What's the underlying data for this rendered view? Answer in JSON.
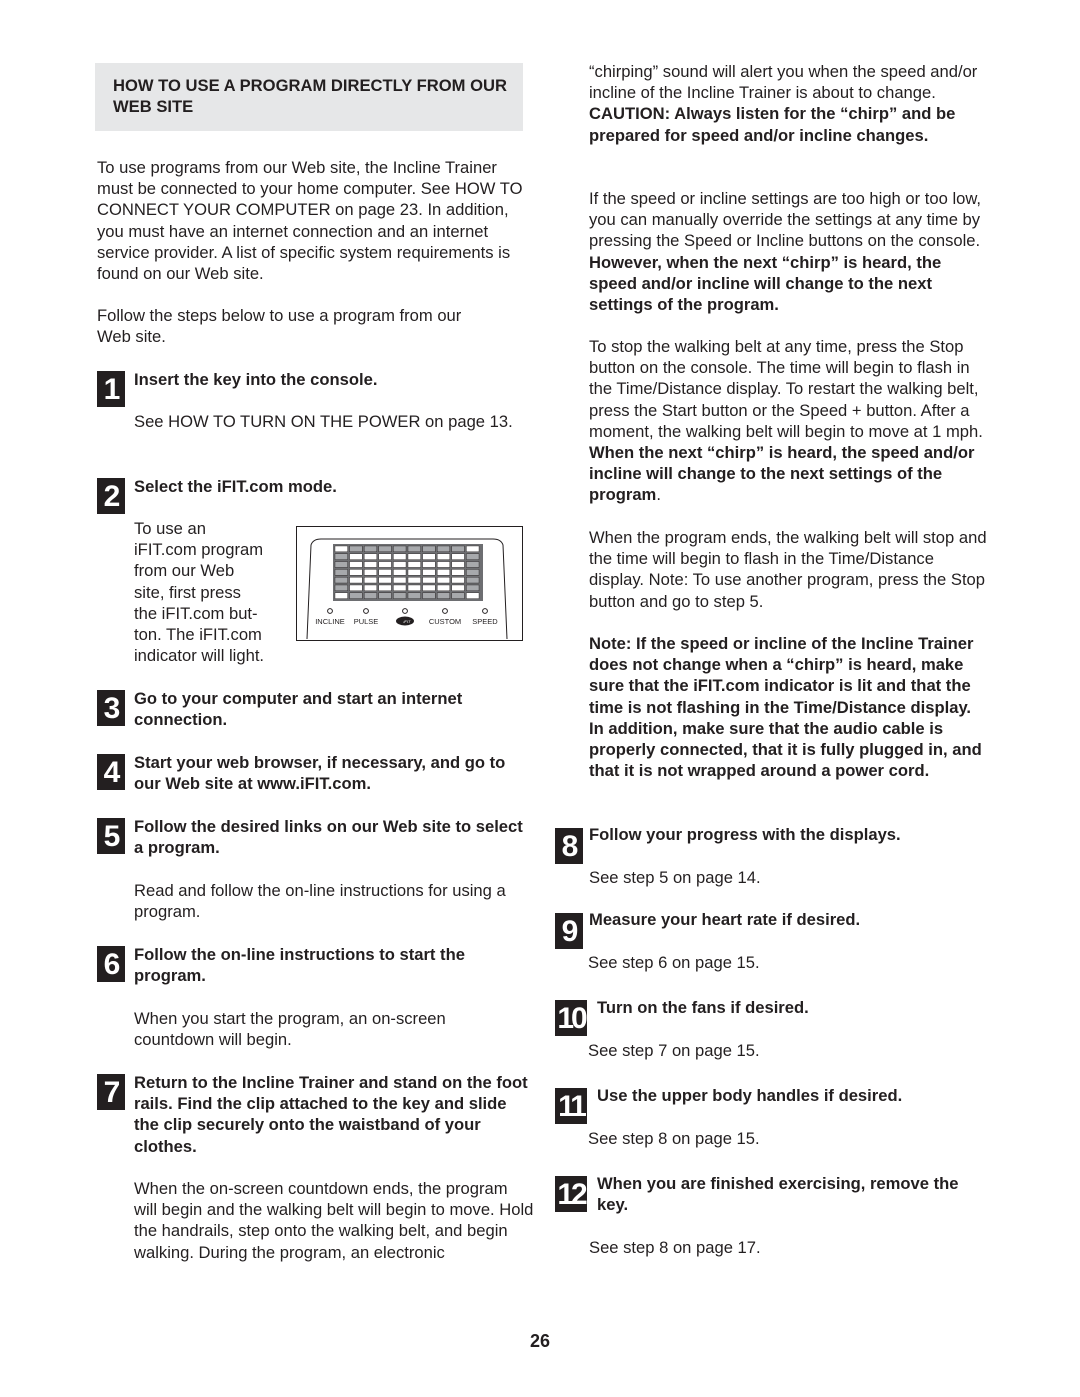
{
  "section_heading": "HOW TO USE A PROGRAM DIRECTLY FROM OUR WEB SITE",
  "intro": [
    "To use programs from our Web site, the Incline Trainer must be connected to your home computer. See HOW TO CONNECT YOUR COMPUTER on page 23. In addition, you must have an internet connection and an internet service provider. A list of specific system requirements is found on our Web site.",
    "Follow the steps below to use a program from our Web site."
  ],
  "steps": [
    {
      "number": "1",
      "title": "Insert the key into the console.",
      "body": "See HOW TO TURN ON THE POWER on page 13."
    },
    {
      "number": "2",
      "title": "Select the iFIT.com mode.",
      "body": "To use an iFIT.com program from our Web site, first press the iFIT.com button. The iFIT.com indicator will light."
    },
    {
      "number": "3",
      "title": "Go to your computer and start an internet connection."
    },
    {
      "number": "4",
      "title": "Start your web browser, if necessary, and go to our Web site at www.iFIT.com."
    },
    {
      "number": "5",
      "title": "Follow the desired links on our Web site to select a program.",
      "body": "Read and follow the on-line instructions for using a program."
    },
    {
      "number": "6",
      "title": "Follow the on-line instructions to start the program.",
      "body": "When you start the program, an on-screen countdown will begin."
    },
    {
      "number": "7",
      "title": "Return to the Incline Trainer and stand on the foot rails. Find the clip attached to the key and slide the clip securely onto the waistband of your clothes.",
      "body": "When the on-screen countdown ends, the program will begin and the walking belt will begin to move. Hold the handrails, step onto the walking belt, and begin walking. During the program, an electronic"
    },
    {
      "number": "8",
      "title": "Follow your progress with the displays.",
      "body": "See step 5 on page 14."
    },
    {
      "number": "9",
      "title": "Measure your heart rate if desired.",
      "body": "See step 6 on page 15."
    },
    {
      "number": "10",
      "title": "Turn on the fans if desired.",
      "body": "See step 7 on page 15."
    },
    {
      "number": "11",
      "title": "Use the upper body handles if desired.",
      "body": "See step 8 on page 15."
    },
    {
      "number": "12",
      "title": "When you are finished exercising, remove the key.",
      "body": "See step 8 on page 17."
    }
  ],
  "step2_lines": [
    "To use an",
    "iFIT.com program",
    "from our Web",
    "site, first press",
    "the iFIT.com but-",
    "ton. The iFIT.com",
    "indicator will light."
  ],
  "console_labels": [
    "INCLINE",
    "PULSE",
    "iFIT.com",
    "CUSTOM",
    "SPEED"
  ],
  "right_column": {
    "p1_plain": "“chirping” sound will alert you when the speed and/or incline of the Incline Trainer is about to change. ",
    "p1_bold": "CAUTION: Always listen for the “chirp” and be prepared for speed and/or incline changes.",
    "p2_plain": "If the speed or incline settings are too high or too low, you can manually override the settings at any time by pressing the Speed or Incline buttons on the console. ",
    "p2_bold": "However, when the next “chirp” is heard, the speed and/or incline will change to the next settings of the program.",
    "p3_plain": "To stop the walking belt at any time, press the Stop button on the console. The time will begin to flash in the Time/Distance display. To restart the walking belt, press the Start button or the Speed + button. After a moment, the walking belt will begin to move at 1 mph. ",
    "p3_bold": "When the next “chirp” is heard, the speed and/or incline will change to the next settings of the program",
    "p3_end": ".",
    "p4": "When the program ends, the walking belt will stop and the time will begin to flash in the Time/Distance display. Note: To use another program, press the Stop button and go to step 5.",
    "note": "Note: If the speed or incline of the Incline Trainer does not change when a “chirp” is heard, make sure that the iFIT.com indicator is lit and that the time is not flashing in the Time/Distance display. In addition, make sure that the audio cable is properly connected, that it is fully plugged in, and that it is not wrapped around a power cord."
  },
  "page_number": "26"
}
